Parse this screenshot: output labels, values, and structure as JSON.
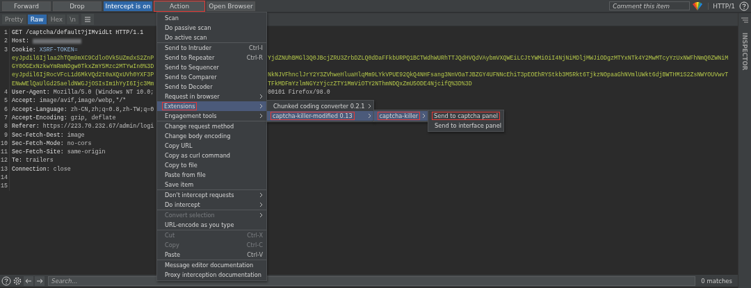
{
  "toolbar": {
    "buttons": [
      {
        "label": "Forward",
        "kind": "plain",
        "annotated": false
      },
      {
        "label": "Drop",
        "kind": "plain",
        "annotated": false
      },
      {
        "label": "Intercept is on",
        "kind": "toggle_on",
        "annotated": false
      },
      {
        "label": "Action",
        "kind": "plain",
        "annotated": true
      },
      {
        "label": "Open Browser",
        "kind": "plain",
        "annotated": false
      }
    ],
    "comment_placeholder": "Comment this item",
    "protocol": "HTTP/1"
  },
  "view_tabs": [
    {
      "label": "Pretty",
      "selected": false
    },
    {
      "label": "Raw",
      "selected": true
    },
    {
      "label": "Hex",
      "selected": false
    },
    {
      "label": "\\n",
      "selected": false
    }
  ],
  "editor": {
    "lines": [
      {
        "number": "1",
        "rows": [
          {
            "kind": "request",
            "text": "GET /captcha/default?jIMvidLt HTTP/1.1"
          }
        ]
      },
      {
        "number": "2",
        "rows": [
          {
            "kind": "header",
            "name": "Host:",
            "redacted": true
          }
        ]
      },
      {
        "number": "3",
        "rows": [
          {
            "kind": "cookie_header",
            "name": "Cookie:",
            "value": "XSRF-TOKEN="
          },
          {
            "kind": "cookie_value",
            "text": "eyJpdil6Ijlaa2hTQm9mXC9CdloOVk5UZmdxS2ZnP",
            "after": "YjdZNUhBMGl3Q0JBcjZRU3ZrbDZLQ0dDaFFkbURPQ1BCTWdhWURhTTJQdHVQdVAybmVXQWEiLCJtYWMiOiI4NjNiMDljMWJiODgzMTYxNTk4Y2MwMTcyYzUxNWFhNmQ0ZWNiM"
          },
          {
            "kind": "cookie_value",
            "text": "GY0OGExNzkwYmRmNDgw0TkxZmY5Mzc2MTYwIn0%3D"
          },
          {
            "kind": "cookie_value",
            "text": "eyJpdil6IjRocVFcL1d6MkVQd2t0aXQxUVh0YXF3P",
            "after": "NkNJVFhnclJrY2Y3ZVhweHluaHlqMm9LYkVPUE92QkQ4NHFsang3NnVOaTJBZGY4UFNNcEhiT3pEOEhRYStkb3M5Rkt6TjkzNOpaaGhNVmlUWkt6djBWTHM1S2ZsNWYOUVwvT"
          },
          {
            "kind": "cookie_value",
            "text": "ENwWElQaUlGd25aeldNWGJjOSIsIm1hYyI6Ijc3Mm",
            "after": "TFkMDFmYzlmNGYzYjczZTY1MmViOTY2NThmNDQxZmU5ODE4NjcifQ%3D%3D"
          }
        ]
      },
      {
        "number": "4",
        "rows": [
          {
            "kind": "header",
            "name": "User-Agent:",
            "value": "Mozilla/5.0 (Windows NT 10.0;",
            "after": "00101 Firefox/98.0"
          }
        ]
      },
      {
        "number": "5",
        "rows": [
          {
            "kind": "header",
            "name": "Accept:",
            "value": "image/avif,image/webp,*/*"
          }
        ]
      },
      {
        "number": "6",
        "rows": [
          {
            "kind": "header",
            "name": "Accept-Language:",
            "value": "zh-CN,zh;q=0.8,zh-TW;q=0"
          }
        ]
      },
      {
        "number": "7",
        "rows": [
          {
            "kind": "header",
            "name": "Accept-Encoding:",
            "value": "gzip, deflate"
          }
        ]
      },
      {
        "number": "8",
        "rows": [
          {
            "kind": "header",
            "name": "Referer:",
            "value": "https://223.70.232.67/admin/logi"
          }
        ]
      },
      {
        "number": "9",
        "rows": [
          {
            "kind": "header",
            "name": "Sec-Fetch-Dest:",
            "value": "image"
          }
        ]
      },
      {
        "number": "10",
        "rows": [
          {
            "kind": "header",
            "name": "Sec-Fetch-Mode:",
            "value": "no-cors"
          }
        ]
      },
      {
        "number": "11",
        "rows": [
          {
            "kind": "header",
            "name": "Sec-Fetch-Site:",
            "value": "same-origin"
          }
        ]
      },
      {
        "number": "12",
        "rows": [
          {
            "kind": "header",
            "name": "Te:",
            "value": "trailers"
          }
        ]
      },
      {
        "number": "13",
        "rows": [
          {
            "kind": "header",
            "name": "Connection:",
            "value": "close"
          }
        ]
      },
      {
        "number": "14"
      },
      {
        "number": "15"
      }
    ]
  },
  "context_menu": {
    "groups": [
      {
        "items": [
          {
            "label": "Scan",
            "submenu": false,
            "disabled": false,
            "selected": false,
            "annotated": false
          },
          {
            "label": "Do passive scan",
            "submenu": false,
            "disabled": false,
            "selected": false,
            "annotated": false
          },
          {
            "label": "Do active scan",
            "submenu": false,
            "disabled": false,
            "selected": false,
            "annotated": false
          }
        ]
      },
      {
        "items": [
          {
            "label": "Send to Intruder",
            "shortcut": "Ctrl-I",
            "submenu": false,
            "disabled": false,
            "selected": false,
            "annotated": false
          },
          {
            "label": "Send to Repeater",
            "shortcut": "Ctrl-R",
            "submenu": false,
            "disabled": false,
            "selected": false,
            "annotated": false
          },
          {
            "label": "Send to Sequencer",
            "submenu": false,
            "disabled": false,
            "selected": false,
            "annotated": false
          },
          {
            "label": "Send to Comparer",
            "submenu": false,
            "disabled": false,
            "selected": false,
            "annotated": false
          },
          {
            "label": "Send to Decoder",
            "submenu": false,
            "disabled": false,
            "selected": false,
            "annotated": false
          },
          {
            "label": "Request in browser",
            "submenu": true,
            "disabled": false,
            "selected": false,
            "annotated": false
          },
          {
            "label": "Extensions",
            "submenu": true,
            "disabled": false,
            "selected": true,
            "annotated": true,
            "children": [
              {
                "label": "Chunked coding converter 0.2.1",
                "submenu": true,
                "disabled": false,
                "selected": false,
                "annotated": false
              },
              {
                "label": "captcha-killer-modified 0.13",
                "submenu": true,
                "disabled": false,
                "selected": true,
                "annotated": true,
                "children": [
                  {
                    "label": "captcha-killer",
                    "submenu": true,
                    "disabled": false,
                    "selected": true,
                    "annotated": true,
                    "children": [
                      {
                        "label": "Send to captcha panel",
                        "submenu": false,
                        "disabled": false,
                        "selected": false,
                        "annotated": true
                      },
                      {
                        "label": "Send to interface panel",
                        "submenu": false,
                        "disabled": false,
                        "selected": false,
                        "annotated": false
                      }
                    ]
                  }
                ]
              }
            ]
          },
          {
            "label": "Engagement tools",
            "submenu": true,
            "disabled": false,
            "selected": false,
            "annotated": false
          }
        ]
      },
      {
        "items": [
          {
            "label": "Change request method",
            "submenu": false,
            "disabled": false,
            "selected": false,
            "annotated": false
          },
          {
            "label": "Change body encoding",
            "submenu": false,
            "disabled": false,
            "selected": false,
            "annotated": false
          },
          {
            "label": "Copy URL",
            "submenu": false,
            "disabled": false,
            "selected": false,
            "annotated": false
          },
          {
            "label": "Copy as curl command",
            "submenu": false,
            "disabled": false,
            "selected": false,
            "annotated": false
          },
          {
            "label": "Copy to file",
            "submenu": false,
            "disabled": false,
            "selected": false,
            "annotated": false
          },
          {
            "label": "Paste from file",
            "submenu": false,
            "disabled": false,
            "selected": false,
            "annotated": false
          },
          {
            "label": "Save item",
            "submenu": false,
            "disabled": false,
            "selected": false,
            "annotated": false
          }
        ]
      },
      {
        "items": [
          {
            "label": "Don't intercept requests",
            "submenu": true,
            "disabled": false,
            "selected": false,
            "annotated": false
          },
          {
            "label": "Do intercept",
            "submenu": true,
            "disabled": false,
            "selected": false,
            "annotated": false
          }
        ]
      },
      {
        "items": [
          {
            "label": "Convert selection",
            "submenu": true,
            "disabled": true,
            "selected": false,
            "annotated": false
          },
          {
            "label": "URL-encode as you type",
            "submenu": false,
            "disabled": false,
            "selected": false,
            "annotated": false
          }
        ]
      },
      {
        "items": [
          {
            "label": "Cut",
            "shortcut": "Ctrl-X",
            "submenu": false,
            "disabled": true,
            "selected": false,
            "annotated": false
          },
          {
            "label": "Copy",
            "shortcut": "Ctrl-C",
            "submenu": false,
            "disabled": true,
            "selected": false,
            "annotated": false
          },
          {
            "label": "Paste",
            "shortcut": "Ctrl-V",
            "submenu": false,
            "disabled": false,
            "selected": false,
            "annotated": false
          }
        ]
      },
      {
        "items": [
          {
            "label": "Message editor documentation",
            "submenu": false,
            "disabled": false,
            "selected": false,
            "annotated": false
          },
          {
            "label": "Proxy interception documentation",
            "submenu": false,
            "disabled": false,
            "selected": false,
            "annotated": false
          }
        ]
      }
    ]
  },
  "inspector": {
    "label": "INSPECTOR"
  },
  "search_bar": {
    "placeholder": "Search...",
    "matches": "0 matches"
  }
}
